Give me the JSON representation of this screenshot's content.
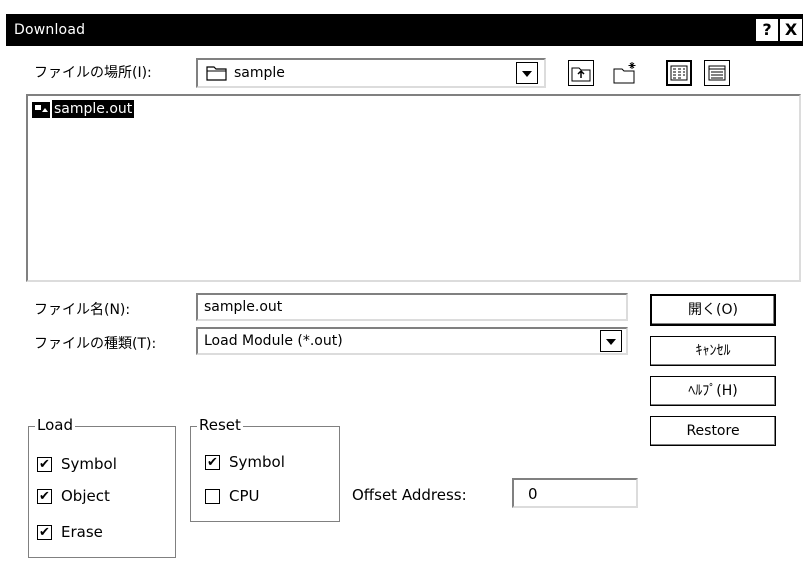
{
  "window": {
    "title": "Download",
    "help_glyph": "?",
    "close_glyph": "X"
  },
  "location": {
    "label": "ファイルの場所(I):",
    "value": "sample"
  },
  "file_list": {
    "items": [
      {
        "name": "sample.out",
        "selected": true
      }
    ]
  },
  "filename": {
    "label": "ファイル名(N):",
    "value": "sample.out"
  },
  "filetype": {
    "label": "ファイルの種類(T):",
    "value": "Load Module (*.out)"
  },
  "buttons": {
    "open": "開く(O)",
    "cancel": "ｷｬﾝｾﾙ",
    "help": "ﾍﾙﾌﾟ(H)",
    "restore": "Restore"
  },
  "load_group": {
    "title": "Load",
    "items": [
      {
        "label": "Symbol",
        "checked": true
      },
      {
        "label": "Object",
        "checked": true
      },
      {
        "label": "Erase",
        "checked": true
      }
    ]
  },
  "reset_group": {
    "title": "Reset",
    "items": [
      {
        "label": "Symbol",
        "checked": true
      },
      {
        "label": "CPU",
        "checked": false
      }
    ]
  },
  "offset": {
    "label": "Offset Address:",
    "value": "0"
  },
  "check_glyph": "✔"
}
